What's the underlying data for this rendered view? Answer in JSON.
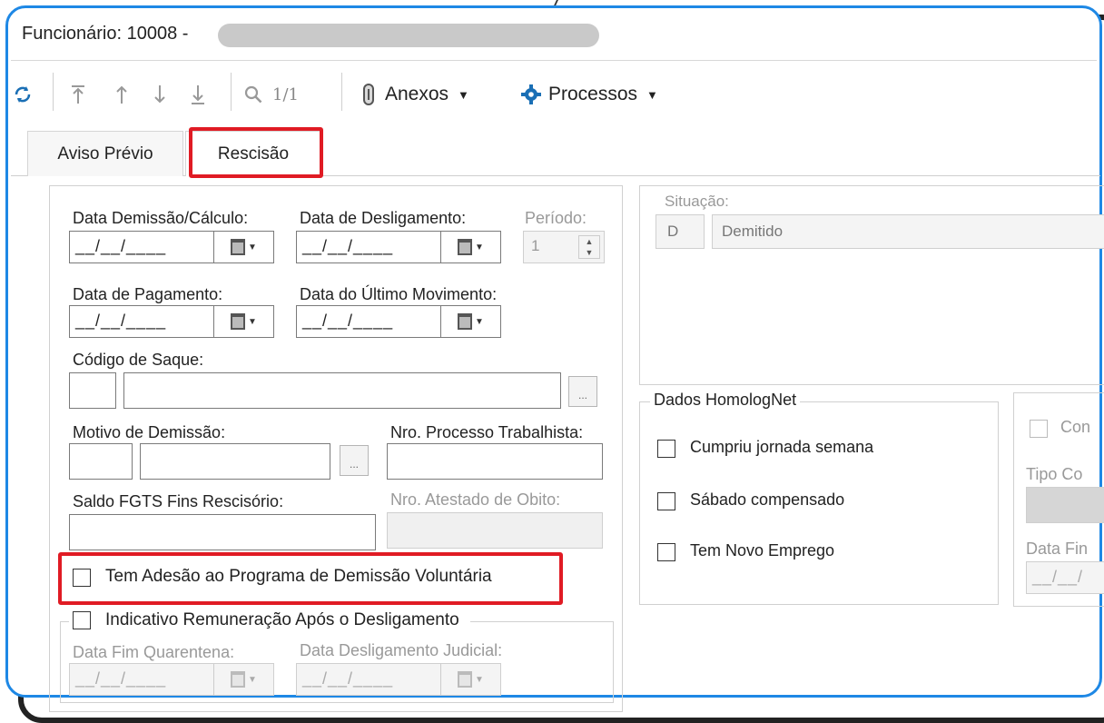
{
  "window": {
    "title": "Funcionário: 10008 -"
  },
  "toolbar": {
    "page_indicator": "1/1",
    "anexos_label": "Anexos",
    "processos_label": "Processos"
  },
  "tabs": [
    {
      "label": "Aviso Prévio",
      "active": false
    },
    {
      "label": "Rescisão",
      "active": true
    }
  ],
  "form": {
    "data_demissao_label": "Data Demissão/Cálculo:",
    "data_demissao_value": "__/__/____",
    "data_desligamento_label": "Data de Desligamento:",
    "data_desligamento_value": "__/__/____",
    "periodo_label": "Período:",
    "periodo_value": "1",
    "data_pagamento_label": "Data de Pagamento:",
    "data_pagamento_value": "__/__/____",
    "data_ultimo_mov_label": "Data do Último Movimento:",
    "data_ultimo_mov_value": "__/__/____",
    "codigo_saque_label": "Código de Saque:",
    "ellipsis": "...",
    "motivo_label": "Motivo de Demissão:",
    "nro_processo_label": "Nro. Processo Trabalhista:",
    "saldo_fgts_label": "Saldo FGTS Fins Rescisório:",
    "nro_atestado_label": "Nro. Atestado de Obito:",
    "adesao_label": "Tem Adesão ao Programa de Demissão Voluntária",
    "indicativo_label": "Indicativo Remuneração Após o Desligamento",
    "data_fim_quarentena_label": "Data Fim Quarentena:",
    "data_fim_quarentena_value": "__/__/____",
    "data_deslig_judicial_label": "Data Desligamento Judicial:",
    "data_deslig_judicial_value": "__/__/____"
  },
  "situacao": {
    "label": "Situação:",
    "code": "D",
    "description": "Demitido"
  },
  "homolognet": {
    "title": "Dados HomologNet",
    "cumpriu_label": "Cumpriu jornada semana",
    "sabado_label": "Sábado compensado",
    "novo_emprego_label": "Tem Novo Emprego"
  },
  "right_panel": {
    "con_label": "Con",
    "tipo_label": "Tipo Co",
    "data_fin_label": "Data Fin",
    "date_partial": "__/__/"
  },
  "colors": {
    "accent_frame": "#1e88e5",
    "highlight_box": "#e01b24"
  },
  "icons": [
    "refresh-icon",
    "move-first-icon",
    "move-up-icon",
    "move-down-icon",
    "move-last-icon",
    "search-icon",
    "paperclip-icon",
    "gear-icon",
    "calendar-icon"
  ]
}
